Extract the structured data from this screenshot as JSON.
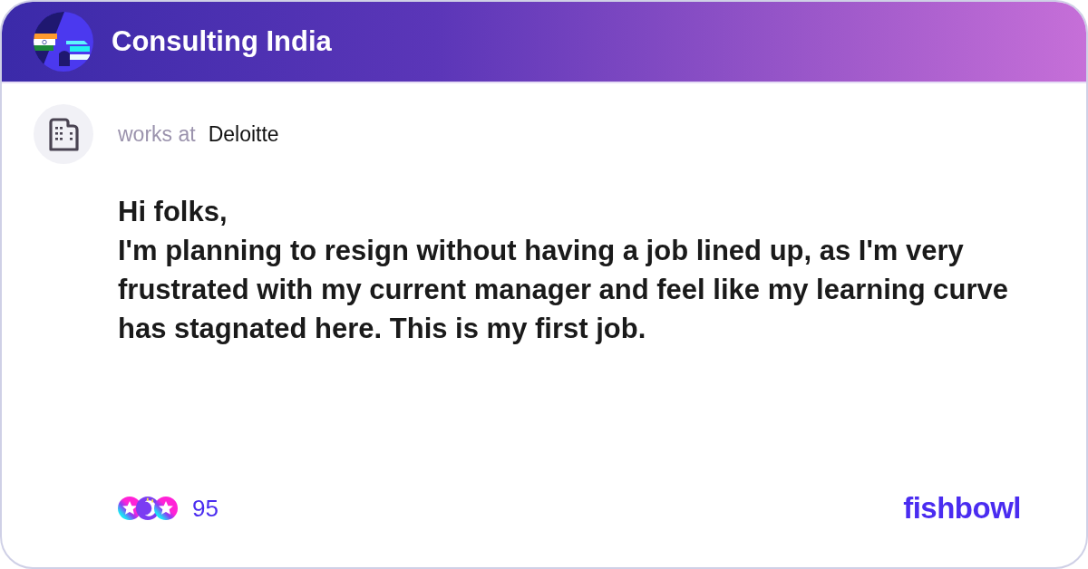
{
  "community": {
    "name": "Consulting India"
  },
  "post": {
    "author": {
      "prefix": "works at",
      "company": "Deloitte"
    },
    "paragraphs": [
      "Hi folks,",
      "I'm planning to resign without having a job lined up, as I'm very frustrated with my current manager and feel like my learning curve has stagnated here. This is my first job."
    ],
    "reactions": {
      "count": "95"
    }
  },
  "brand": {
    "logo": "fishbowl"
  }
}
